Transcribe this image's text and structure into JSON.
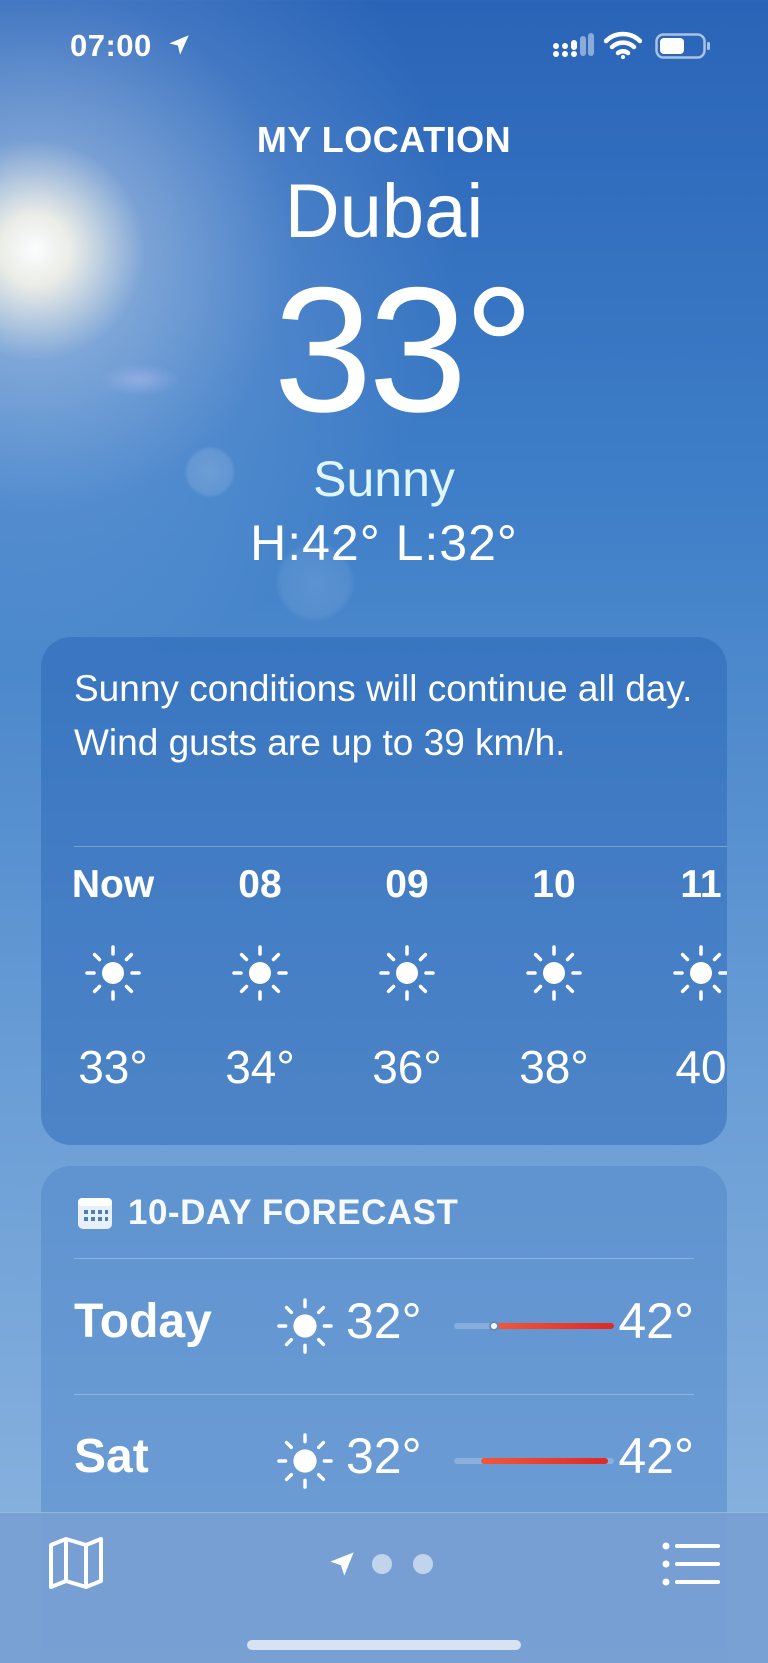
{
  "status_bar": {
    "time": "07:00",
    "icons": [
      "location-arrow-icon",
      "cellular-signal-icon",
      "wifi-icon",
      "battery-icon"
    ]
  },
  "header": {
    "label": "MY LOCATION",
    "city": "Dubai",
    "temperature": "33°",
    "condition": "Sunny",
    "high_low": "H:42°  L:32°"
  },
  "summary": {
    "text": "Sunny conditions will continue all day. Wind gusts are up to 39 km/h."
  },
  "hourly": [
    {
      "time": "Now",
      "icon": "sun-icon",
      "temp": "33°"
    },
    {
      "time": "08",
      "icon": "sun-icon",
      "temp": "34°"
    },
    {
      "time": "09",
      "icon": "sun-icon",
      "temp": "36°"
    },
    {
      "time": "10",
      "icon": "sun-icon",
      "temp": "38°"
    },
    {
      "time": "11",
      "icon": "sun-icon",
      "temp": "40"
    }
  ],
  "forecast": {
    "title": "10-DAY FORECAST",
    "icon": "calendar-icon",
    "days": [
      {
        "day": "Today",
        "icon": "sun-icon",
        "low": "32°",
        "high": "42°",
        "range_start": 0.25,
        "range_end": 1.0,
        "current_marker": 0.25
      },
      {
        "day": "Sat",
        "icon": "sun-icon",
        "low": "32°",
        "high": "42°",
        "range_start": 0.17,
        "range_end": 0.96
      }
    ]
  },
  "toolbar": {
    "map_icon": "map-icon",
    "current_location_icon": "location-arrow-icon",
    "page_count": 3,
    "list_icon": "list-icon"
  },
  "colors": {
    "sky_top": "#2a64b8",
    "sky_bottom": "#8fb6e0",
    "range_bar": "#de2a24",
    "condition_text": "#dff6ff"
  }
}
